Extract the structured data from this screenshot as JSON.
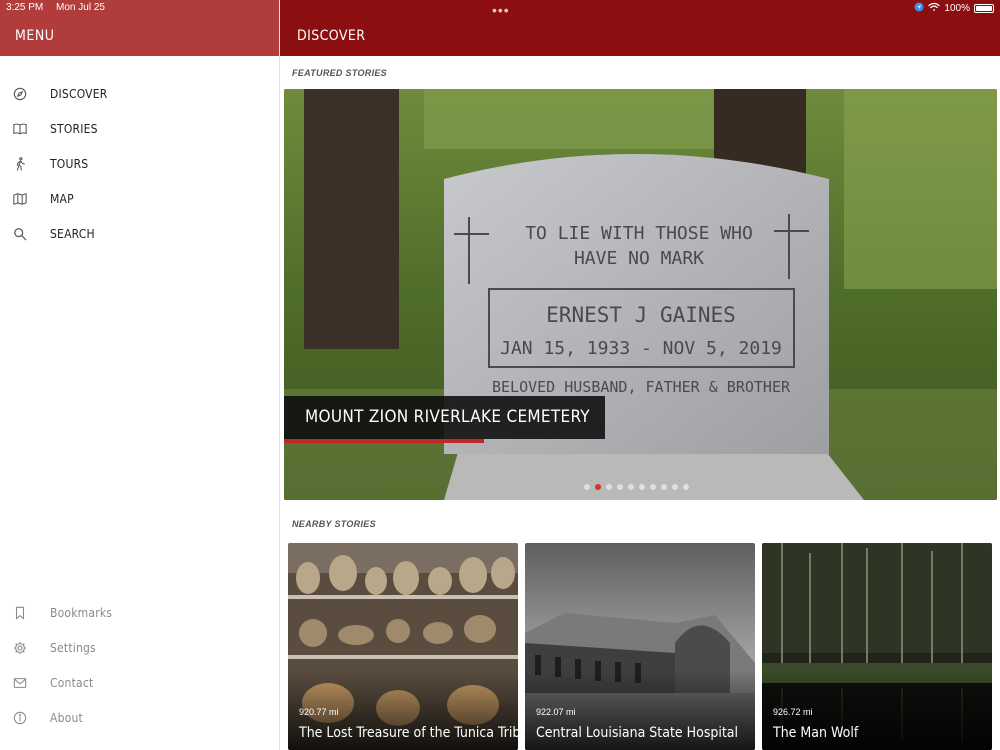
{
  "status_bar": {
    "time": "3:25 PM",
    "date": "Mon Jul 25",
    "battery": "100%",
    "multitask_dots": "•••"
  },
  "sidebar": {
    "title": "MENU",
    "items": [
      {
        "label": "DISCOVER",
        "icon": "compass-icon"
      },
      {
        "label": "STORIES",
        "icon": "book-icon"
      },
      {
        "label": "TOURS",
        "icon": "walking-icon"
      },
      {
        "label": "MAP",
        "icon": "map-icon"
      },
      {
        "label": "SEARCH",
        "icon": "search-icon"
      }
    ],
    "secondary_items": [
      {
        "label": "Bookmarks",
        "icon": "bookmark-icon"
      },
      {
        "label": "Settings",
        "icon": "gear-icon"
      },
      {
        "label": "Contact",
        "icon": "envelope-icon"
      },
      {
        "label": "About",
        "icon": "info-icon"
      }
    ]
  },
  "header": {
    "title": "DISCOVER"
  },
  "featured": {
    "section_label": "FEATURED STORIES",
    "slide_title": "MOUNT ZION RIVERLAKE CEMETERY",
    "headstone_lines": [
      "TO LIE WITH THOSE WHO",
      "HAVE NO MARK",
      "ERNEST J  GAINES",
      "JAN 15, 1933 - NOV 5, 2019",
      "BELOVED HUSBAND, FATHER & BROTHER"
    ],
    "slide_count": 10,
    "active_slide": 2
  },
  "nearby": {
    "section_label": "NEARBY STORIES",
    "cards": [
      {
        "distance": "920.77 mi",
        "title": "The Lost Treasure of the Tunica Tribe"
      },
      {
        "distance": "922.07 mi",
        "title": "Central Louisiana State Hospital"
      },
      {
        "distance": "926.72 mi",
        "title": "The Man Wolf"
      }
    ]
  },
  "colors": {
    "sidebar_header": "#b13c3c",
    "main_header": "#8b0e10",
    "accent": "#c0282a"
  }
}
